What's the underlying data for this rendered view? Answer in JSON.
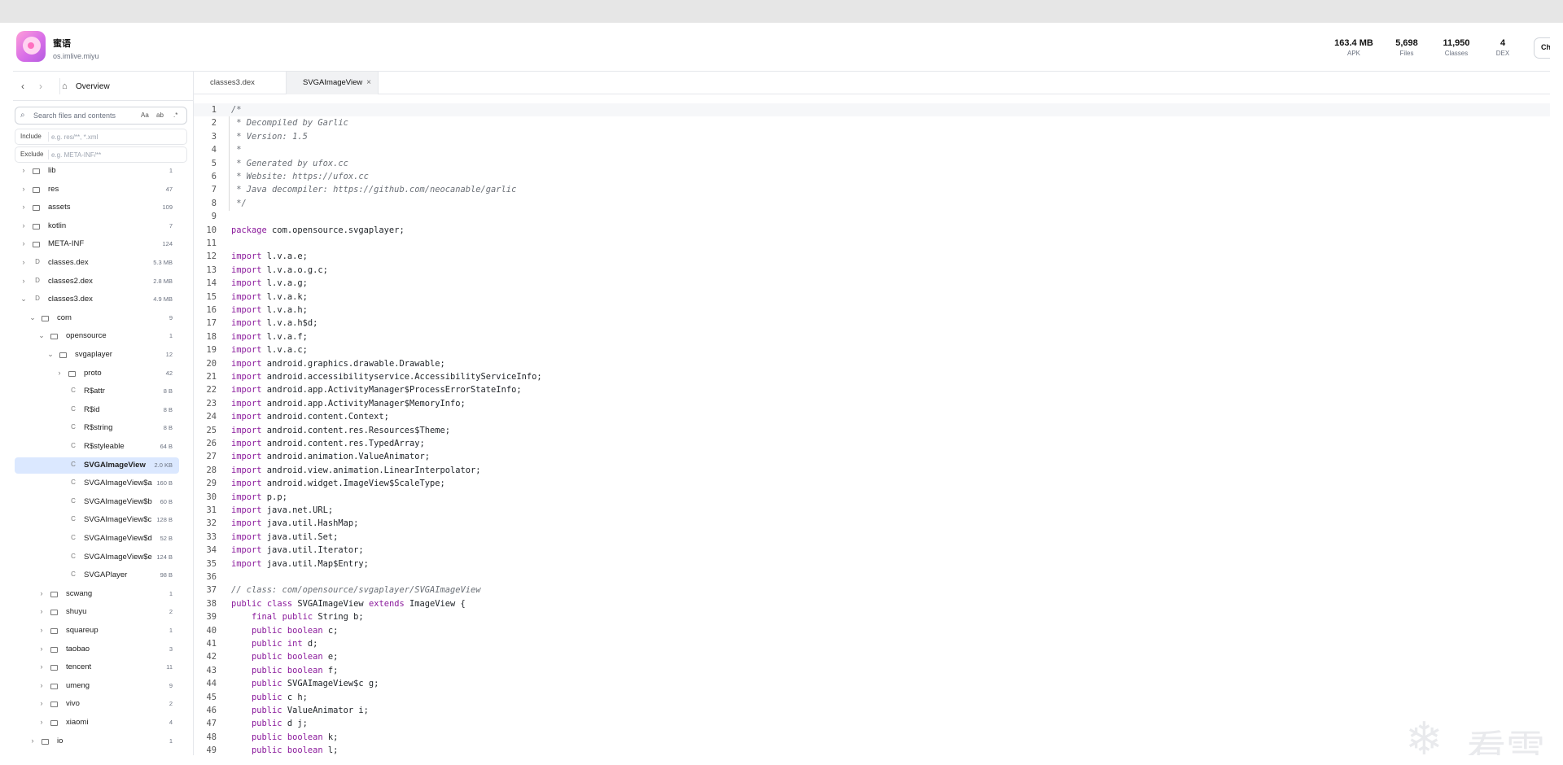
{
  "app": {
    "name": "蜜语",
    "package": "os.imlive.miyu"
  },
  "stats": [
    {
      "value": "163.4 MB",
      "label": "APK"
    },
    {
      "value": "5,698",
      "label": "Files"
    },
    {
      "value": "11,950",
      "label": "Classes"
    },
    {
      "value": "4",
      "label": "DEX"
    }
  ],
  "header": {
    "check_label": "Ch"
  },
  "nav": {
    "back": "‹",
    "forward": "›",
    "overview_label": "Overview"
  },
  "search": {
    "placeholder": "Search files and contents",
    "option_case": "Aa",
    "option_word": "ab",
    "option_regex": ".*"
  },
  "filters": {
    "include_label": "Include",
    "include_placeholder": "e.g. res/**, *.xml",
    "exclude_label": "Exclude",
    "exclude_placeholder": "e.g. META-INF/**"
  },
  "tree": [
    {
      "name": "lib",
      "count": "1",
      "kind": "folder",
      "level": 0,
      "state": "collapsed"
    },
    {
      "name": "res",
      "count": "47",
      "kind": "folder",
      "level": 0,
      "state": "collapsed"
    },
    {
      "name": "assets",
      "count": "109",
      "kind": "folder",
      "level": 0,
      "state": "collapsed"
    },
    {
      "name": "kotlin",
      "count": "7",
      "kind": "folder",
      "level": 0,
      "state": "collapsed"
    },
    {
      "name": "META-INF",
      "count": "124",
      "kind": "folder",
      "level": 0,
      "state": "collapsed"
    },
    {
      "name": "classes.dex",
      "count": "5.3 MB",
      "kind": "dex",
      "level": 0,
      "state": "collapsed"
    },
    {
      "name": "classes2.dex",
      "count": "2.8 MB",
      "kind": "dex",
      "level": 0,
      "state": "collapsed"
    },
    {
      "name": "classes3.dex",
      "count": "4.9 MB",
      "kind": "dex",
      "level": 0,
      "state": "expanded"
    },
    {
      "name": "com",
      "count": "9",
      "kind": "folder",
      "level": 1,
      "state": "expanded"
    },
    {
      "name": "opensource",
      "count": "1",
      "kind": "folder",
      "level": 2,
      "state": "expanded"
    },
    {
      "name": "svgaplayer",
      "count": "12",
      "kind": "folder",
      "level": 3,
      "state": "expanded"
    },
    {
      "name": "proto",
      "count": "42",
      "kind": "folder",
      "level": 4,
      "state": "collapsed"
    },
    {
      "name": "R$attr",
      "count": "8 B",
      "kind": "class",
      "level": 4,
      "state": "leaf"
    },
    {
      "name": "R$id",
      "count": "8 B",
      "kind": "class",
      "level": 4,
      "state": "leaf"
    },
    {
      "name": "R$string",
      "count": "8 B",
      "kind": "class",
      "level": 4,
      "state": "leaf"
    },
    {
      "name": "R$styleable",
      "count": "64 B",
      "kind": "class",
      "level": 4,
      "state": "leaf"
    },
    {
      "name": "SVGAImageView",
      "count": "2.0 KB",
      "kind": "class",
      "level": 4,
      "state": "leaf",
      "selected": true
    },
    {
      "name": "SVGAImageView$a",
      "count": "160 B",
      "kind": "class",
      "level": 4,
      "state": "leaf"
    },
    {
      "name": "SVGAImageView$b",
      "count": "60 B",
      "kind": "class",
      "level": 4,
      "state": "leaf"
    },
    {
      "name": "SVGAImageView$c",
      "count": "128 B",
      "kind": "class",
      "level": 4,
      "state": "leaf"
    },
    {
      "name": "SVGAImageView$d",
      "count": "52 B",
      "kind": "class",
      "level": 4,
      "state": "leaf"
    },
    {
      "name": "SVGAImageView$e",
      "count": "124 B",
      "kind": "class",
      "level": 4,
      "state": "leaf"
    },
    {
      "name": "SVGAPlayer",
      "count": "98 B",
      "kind": "class",
      "level": 4,
      "state": "leaf"
    },
    {
      "name": "scwang",
      "count": "1",
      "kind": "folder",
      "level": 2,
      "state": "collapsed"
    },
    {
      "name": "shuyu",
      "count": "2",
      "kind": "folder",
      "level": 2,
      "state": "collapsed"
    },
    {
      "name": "squareup",
      "count": "1",
      "kind": "folder",
      "level": 2,
      "state": "collapsed"
    },
    {
      "name": "taobao",
      "count": "3",
      "kind": "folder",
      "level": 2,
      "state": "collapsed"
    },
    {
      "name": "tencent",
      "count": "11",
      "kind": "folder",
      "level": 2,
      "state": "collapsed"
    },
    {
      "name": "umeng",
      "count": "9",
      "kind": "folder",
      "level": 2,
      "state": "collapsed"
    },
    {
      "name": "vivo",
      "count": "2",
      "kind": "folder",
      "level": 2,
      "state": "collapsed"
    },
    {
      "name": "xiaomi",
      "count": "4",
      "kind": "folder",
      "level": 2,
      "state": "collapsed"
    },
    {
      "name": "io",
      "count": "1",
      "kind": "folder",
      "level": 1,
      "state": "collapsed"
    }
  ],
  "tabs": [
    {
      "label": "classes3.dex",
      "active": false
    },
    {
      "label": "SVGAImageView",
      "active": true,
      "close": "×"
    }
  ],
  "code_lines": [
    "/*",
    " * Decompiled by Garlic",
    " * Version: 1.5",
    " *",
    " * Generated by ufox.cc",
    " * Website: https://ufox.cc",
    " * Java decompiler: https://github.com/neocanable/garlic",
    " */",
    "",
    "package com.opensource.svgaplayer;",
    "",
    "import l.v.a.e;",
    "import l.v.a.o.g.c;",
    "import l.v.a.g;",
    "import l.v.a.k;",
    "import l.v.a.h;",
    "import l.v.a.h$d;",
    "import l.v.a.f;",
    "import l.v.a.c;",
    "import android.graphics.drawable.Drawable;",
    "import android.accessibilityservice.AccessibilityServiceInfo;",
    "import android.app.ActivityManager$ProcessErrorStateInfo;",
    "import android.app.ActivityManager$MemoryInfo;",
    "import android.content.Context;",
    "import android.content.res.Resources$Theme;",
    "import android.content.res.TypedArray;",
    "import android.animation.ValueAnimator;",
    "import android.view.animation.LinearInterpolator;",
    "import android.widget.ImageView$ScaleType;",
    "import p.p;",
    "import java.net.URL;",
    "import java.util.HashMap;",
    "import java.util.Set;",
    "import java.util.Iterator;",
    "import java.util.Map$Entry;",
    "",
    "// class: com/opensource/svgaplayer/SVGAImageView",
    "public class SVGAImageView extends ImageView {",
    "    final public String b;",
    "    public boolean c;",
    "    public int d;",
    "    public boolean e;",
    "    public boolean f;",
    "    public SVGAImageView$c g;",
    "    public c h;",
    "    public ValueAnimator i;",
    "    public d j;",
    "    public boolean k;",
    "    public boolean l;"
  ],
  "watermark": {
    "text": "看雪",
    "icon": "snowflake-icon"
  },
  "colors": {
    "accent": "#dbe8ff",
    "keyword": "#8b1a9c",
    "comment": "#6a6f76"
  }
}
